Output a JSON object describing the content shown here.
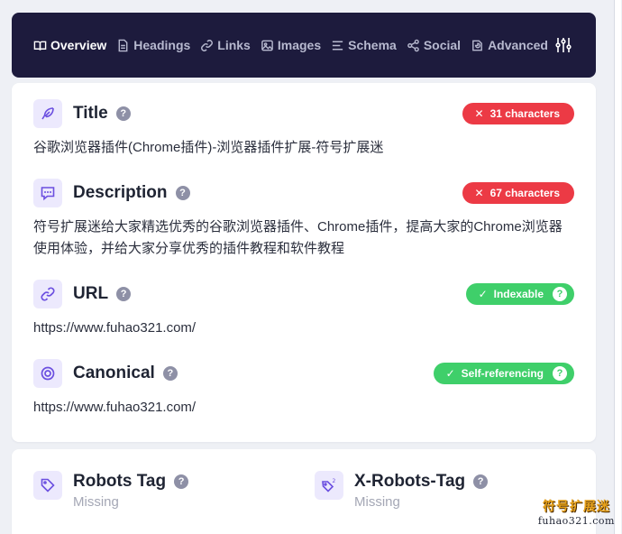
{
  "nav": {
    "items": [
      {
        "label": "Overview",
        "icon": "book-open-icon"
      },
      {
        "label": "Headings",
        "icon": "document-icon"
      },
      {
        "label": "Links",
        "icon": "link-icon"
      },
      {
        "label": "Images",
        "icon": "image-icon"
      },
      {
        "label": "Schema",
        "icon": "list-icon"
      },
      {
        "label": "Social",
        "icon": "share-icon"
      },
      {
        "label": "Advanced",
        "icon": "pie-chart-icon"
      }
    ],
    "settings_icon": "sliders-icon"
  },
  "sections": {
    "title": {
      "label": "Title",
      "badge": "31 characters",
      "badge_type": "error",
      "text": "谷歌浏览器插件(Chrome插件)-浏览器插件扩展-符号扩展迷"
    },
    "description": {
      "label": "Description",
      "badge": "67 characters",
      "badge_type": "error",
      "text": "符号扩展迷给大家精选优秀的谷歌浏览器插件、Chrome插件，提高大家的Chrome浏览器使用体验，并给大家分享优秀的插件教程和软件教程"
    },
    "url": {
      "label": "URL",
      "badge": "Indexable",
      "badge_type": "ok",
      "text": "https://www.fuhao321.com/"
    },
    "canonical": {
      "label": "Canonical",
      "badge": "Self-referencing",
      "badge_type": "ok",
      "text": "https://www.fuhao321.com/"
    }
  },
  "robots": {
    "robots_tag": {
      "label": "Robots Tag",
      "value": "Missing"
    },
    "x_robots_tag": {
      "label": "X-Robots-Tag",
      "value": "Missing"
    }
  },
  "watermark": {
    "line1": "符号扩展迷",
    "line2": "fuhao321.com"
  },
  "colors": {
    "nav_bg": "#1d1b3d",
    "accent": "#6b4fe0",
    "error": "#ec3a45",
    "ok": "#3fcf6a"
  }
}
